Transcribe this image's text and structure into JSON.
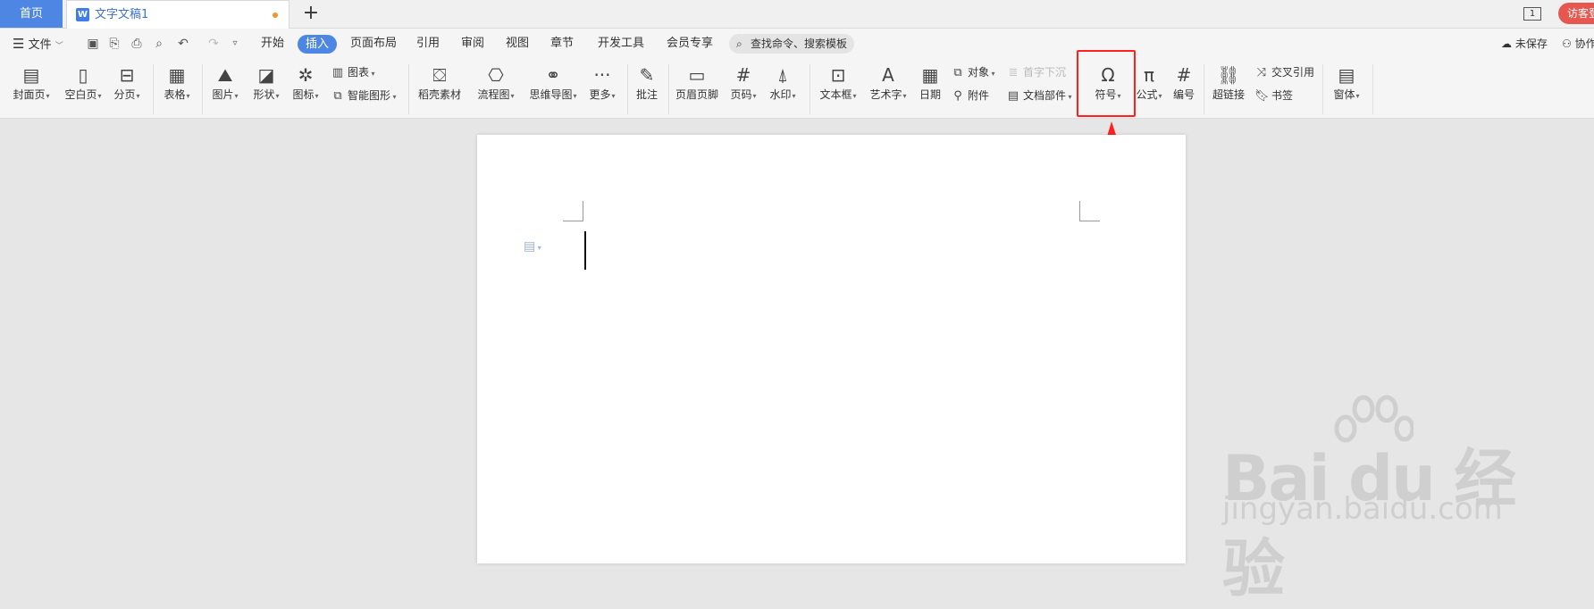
{
  "tabs": {
    "home": "首页",
    "document": "文字文稿1",
    "add": "+",
    "page_count": "1",
    "visitor": "访客登"
  },
  "menu": {
    "file": "文件",
    "items": [
      "开始",
      "插入",
      "页面布局",
      "引用",
      "审阅",
      "视图",
      "章节",
      "开发工具",
      "会员专享"
    ],
    "active": "插入",
    "search_placeholder": "查找命令、搜索模板",
    "unsaved": "未保存",
    "collab": "协作"
  },
  "ribbon": {
    "cover": "封面页",
    "blank": "空白页",
    "pagebreak": "分页",
    "table": "表格",
    "picture": "图片",
    "shape": "形状",
    "icon": "图标",
    "chart": "图表",
    "smartart": "智能图形",
    "docer": "稻壳素材",
    "flowchart": "流程图",
    "mindmap": "思维导图",
    "more": "更多",
    "comment": "批注",
    "header_footer": "页眉页脚",
    "page_number": "页码",
    "watermark": "水印",
    "textbox": "文本框",
    "wordart": "艺术字",
    "date": "日期",
    "object": "对象",
    "attachment": "附件",
    "dropcap": "首字下沉",
    "docparts": "文档部件",
    "symbol": "符号",
    "formula": "公式",
    "numbering": "编号",
    "hyperlink": "超链接",
    "crossref": "交叉引用",
    "bookmark": "书签",
    "window": "窗体"
  },
  "watermark": {
    "brand": "Bai du 经验",
    "url": "jingyan.baidu.com"
  },
  "colors": {
    "accent": "#4e86e4",
    "highlight": "#ff2020",
    "visitor": "#e6584f"
  }
}
